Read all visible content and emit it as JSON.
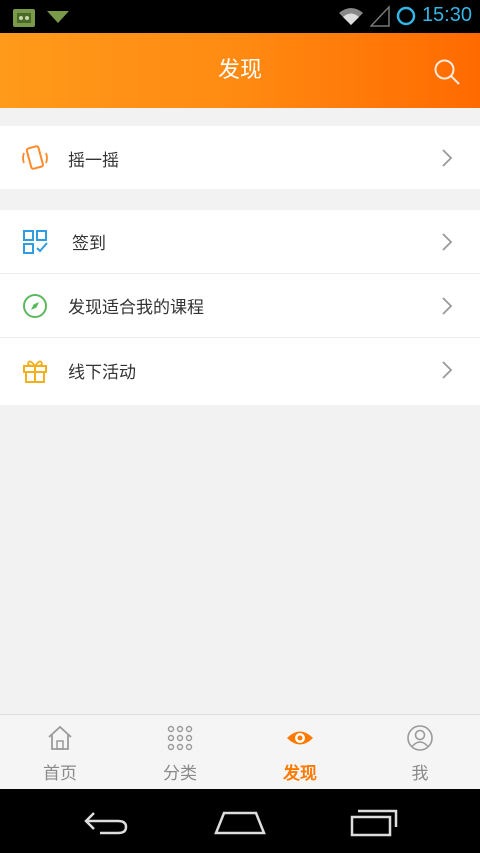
{
  "status_bar": {
    "time": "15:30",
    "icons": [
      "android-app-icon",
      "notification-icon",
      "wifi-icon",
      "signal-icon",
      "sync-icon"
    ]
  },
  "header": {
    "title": "发现",
    "search_icon": "search-icon"
  },
  "groups": [
    {
      "items": [
        {
          "label": "摇一摇",
          "icon": "shake-phone-icon",
          "icon_color": "#ff8a2a"
        }
      ]
    },
    {
      "items": [
        {
          "label": "签到",
          "icon": "checkin-grid-icon",
          "icon_color": "#2f9de0"
        },
        {
          "label": "发现适合我的课程",
          "icon": "compass-icon",
          "icon_color": "#5cb85c"
        },
        {
          "label": "线下活动",
          "icon": "gift-icon",
          "icon_color": "#f2b01e"
        }
      ]
    }
  ],
  "tabbar": {
    "tabs": [
      {
        "label": "首页",
        "icon": "home-icon",
        "active": false
      },
      {
        "label": "分类",
        "icon": "category-grid-icon",
        "active": false
      },
      {
        "label": "发现",
        "icon": "eye-icon",
        "active": true
      },
      {
        "label": "我",
        "icon": "profile-icon",
        "active": false
      }
    ],
    "active_color": "#ff7a00",
    "inactive_color": "#8a8a8a"
  },
  "nav_bar": {
    "buttons": [
      "back-icon",
      "home-nav-icon",
      "recents-icon"
    ]
  },
  "colors": {
    "header_start": "#ff9a1a",
    "header_end": "#ff6a00",
    "status_accent": "#33b5e5"
  }
}
